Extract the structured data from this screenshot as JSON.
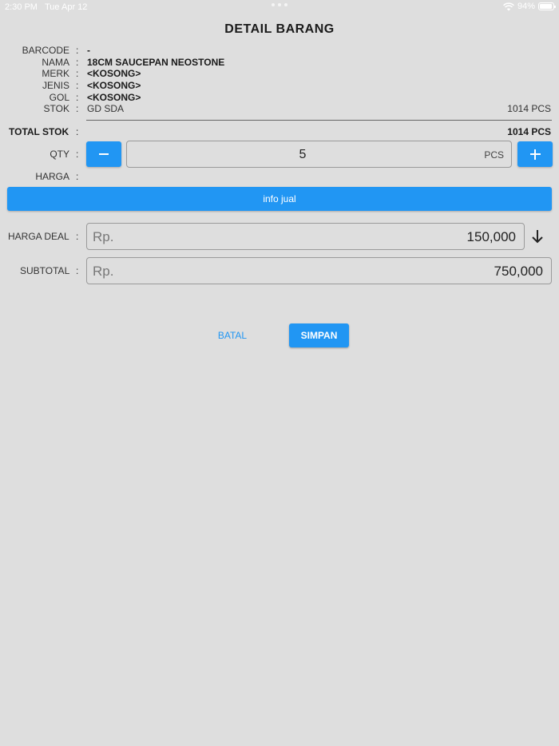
{
  "status_bar": {
    "time": "2:30 PM",
    "date": "Tue Apr 12",
    "battery": "94%",
    "battery_level": 0.94,
    "icons": [
      "wifi-icon",
      "battery-icon"
    ]
  },
  "title": "DETAIL BARANG",
  "separator": ":",
  "details": {
    "barcode": {
      "label": "BARCODE",
      "value": "-"
    },
    "nama": {
      "label": "NAMA",
      "value": "18CM SAUCEPAN NEOSTONE"
    },
    "merk": {
      "label": "MERK",
      "value": "<KOSONG>"
    },
    "jenis": {
      "label": "JENIS",
      "value": "<KOSONG>"
    },
    "gol": {
      "label": "GOL",
      "value": "<KOSONG>"
    },
    "stok": {
      "label": "STOK",
      "location": "GD SDA",
      "qty": "1014 PCS"
    }
  },
  "total_stok": {
    "label": "TOTAL STOK",
    "value": "1014 PCS"
  },
  "qty": {
    "label": "QTY",
    "value": "5",
    "unit": "PCS"
  },
  "harga": {
    "label": "HARGA"
  },
  "info_jual": {
    "label": "info jual"
  },
  "harga_deal": {
    "label": "HARGA DEAL",
    "prefix": "Rp.",
    "value": "150,000"
  },
  "subtotal": {
    "label": "SUBTOTAL",
    "prefix": "Rp.",
    "value": "750,000"
  },
  "actions": {
    "cancel": "BATAL",
    "save": "SIMPAN"
  },
  "colors": {
    "accent": "#2196f3",
    "background": "#dedede"
  }
}
